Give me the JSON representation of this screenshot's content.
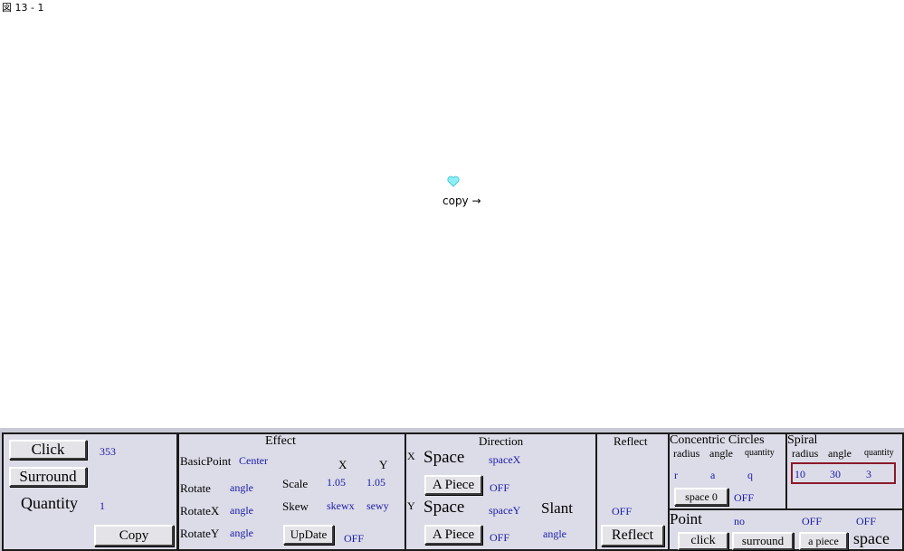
{
  "figure_label": "図 13 - 1",
  "stage": {
    "copy_note": "copy →",
    "heart_icon": "heart-icon"
  },
  "left_panel": {
    "click_button": "Click",
    "click_value": "353",
    "surround_button": "Surround",
    "quantity_label": "Quantity",
    "quantity_value": "1",
    "copy_button": "Copy"
  },
  "effect": {
    "title": "Effect",
    "basicpoint_label": "BasicPoint",
    "basicpoint_value": "Center",
    "x_header": "X",
    "y_header": "Y",
    "rotate_label": "Rotate",
    "rotate_value": "angle",
    "scale_label": "Scale",
    "scale_x": "1.05",
    "scale_y": "1.05",
    "rotatex_label": "RotateX",
    "rotatex_value": "angle",
    "skew_label": "Skew",
    "skew_x": "skewx",
    "skew_y": "sewy",
    "rotatey_label": "RotateY",
    "rotatey_value": "angle",
    "update_button": "UpDate",
    "update_state": "OFF"
  },
  "direction": {
    "title": "Direction",
    "x_marker": "X",
    "x_space_label": "Space",
    "x_space_value": "spaceX",
    "x_piece_button": "A Piece",
    "x_piece_state": "OFF",
    "y_marker": "Y",
    "y_space_label": "Space",
    "y_space_value": "spaceY",
    "slant_label": "Slant",
    "y_piece_button": "A Piece",
    "y_piece_state": "OFF",
    "slant_value": "angle"
  },
  "reflect": {
    "title": "Reflect",
    "state": "OFF",
    "button": "Reflect"
  },
  "concentric": {
    "title": "Concentric Circles",
    "radius_header": "radius",
    "angle_header": "angle",
    "quantity_header": "quantity",
    "radius_value": "r",
    "angle_value": "a",
    "quantity_value": "q",
    "space0_button": "space 0",
    "space0_state": "OFF"
  },
  "spiral": {
    "title": "Spiral",
    "radius_header": "radius",
    "angle_header": "angle",
    "quantity_header": "quantity",
    "radius_value": "10",
    "angle_value": "30",
    "quantity_value": "3"
  },
  "point": {
    "title": "Point",
    "value": "no",
    "state1": "OFF",
    "state2": "OFF",
    "click_button": "click",
    "surround_button": "surround",
    "apiece_button": "a piece",
    "space_label": "space"
  },
  "colors": {
    "panel_bg": "#c9c9d6",
    "box_bg": "#dcdce8",
    "value_blue": "#1a1aa8",
    "heart": "#7ae6ee",
    "spiral_border": "#8a1a2a"
  }
}
